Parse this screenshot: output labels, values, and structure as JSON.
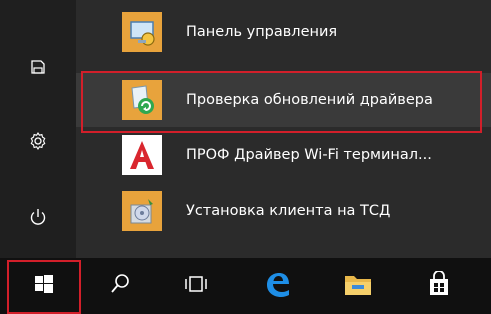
{
  "start_menu": {
    "apps": [
      {
        "label": "Панель управления",
        "icon": "control-panel-icon"
      },
      {
        "label": "Проверка обновлений драйвера",
        "icon": "driver-update-icon",
        "highlighted": true
      },
      {
        "label": "ПРОФ Драйвер Wi-Fi терминал...",
        "icon": "prof-driver-icon"
      },
      {
        "label": "Установка клиента на ТСД",
        "icon": "install-client-icon"
      }
    ],
    "left_rail": [
      "documents-icon",
      "settings-icon",
      "power-icon"
    ]
  },
  "taskbar": {
    "buttons": [
      "windows-start-icon",
      "search-icon",
      "task-view-icon",
      "edge-browser-icon",
      "file-explorer-icon",
      "store-icon"
    ]
  },
  "colors": {
    "menu_bg": "#2b2b2b",
    "rail_bg": "#1f1f1f",
    "taskbar_bg": "#101010",
    "icon_tile": "#e8a33c",
    "highlight_red": "#d21f2a",
    "edge_blue": "#1e8ee6"
  }
}
